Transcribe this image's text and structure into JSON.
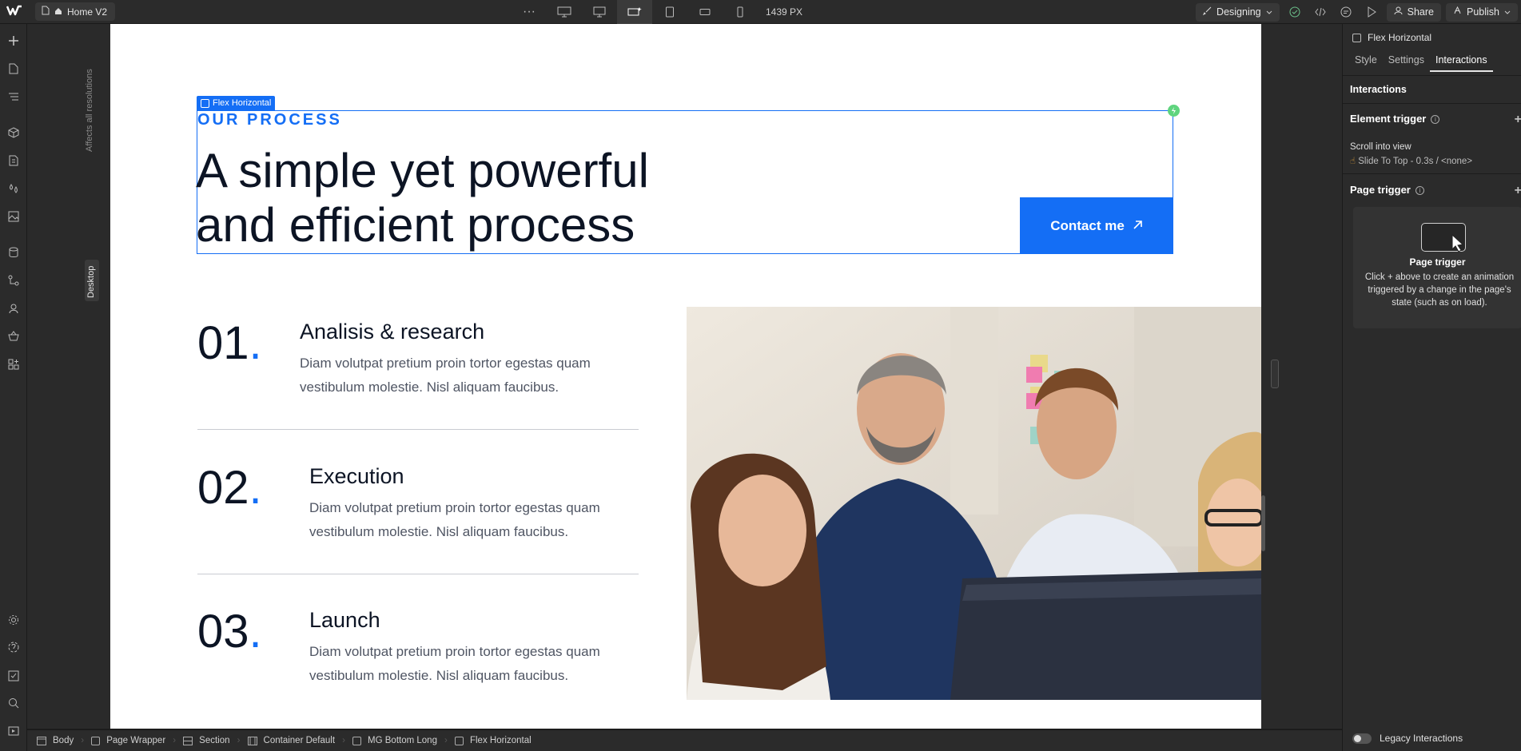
{
  "topbar": {
    "page_name": "Home V2",
    "width_readout": "1439 PX",
    "more_label": "···",
    "mode_label": "Designing",
    "share_label": "Share",
    "publish_label": "Publish"
  },
  "canvas": {
    "affects_label": "Affects all resolutions",
    "breakpoint_label": "Desktop",
    "selection_label": "Flex Horizontal"
  },
  "page": {
    "eyebrow": "OUR PROCESS",
    "heading_line1": "A simple yet powerful",
    "heading_line2": "and efficient process",
    "cta_label": "Contact me",
    "steps": [
      {
        "num": "01",
        "dot": ".",
        "title": "Analisis & research",
        "desc": "Diam volutpat pretium proin tortor egestas quam vestibulum molestie. Nisl aliquam faucibus."
      },
      {
        "num": "02",
        "dot": ".",
        "title": "Execution",
        "desc": "Diam volutpat pretium proin tortor egestas quam vestibulum molestie. Nisl aliquam faucibus."
      },
      {
        "num": "03",
        "dot": ".",
        "title": "Launch",
        "desc": "Diam volutpat pretium proin tortor egestas quam vestibulum molestie. Nisl aliquam faucibus."
      }
    ],
    "accent_color": "#146ef5"
  },
  "panel": {
    "element_name": "Flex Horizontal",
    "tabs": [
      "Style",
      "Settings",
      "Interactions"
    ],
    "section_label": "Interactions",
    "element_trigger_title": "Element trigger",
    "trigger_name": "Scroll into view",
    "trigger_detail": "Slide To Top - 0.3s / <none>",
    "page_trigger_title": "Page trigger",
    "card_title": "Page trigger",
    "card_desc": "Click + above to create an animation triggered by a change in the page's state (such as on load).",
    "legacy_label": "Legacy Interactions"
  },
  "breadcrumbs": [
    "Body",
    "Page Wrapper",
    "Section",
    "Container Default",
    "MG Bottom Long",
    "Flex Horizontal"
  ]
}
